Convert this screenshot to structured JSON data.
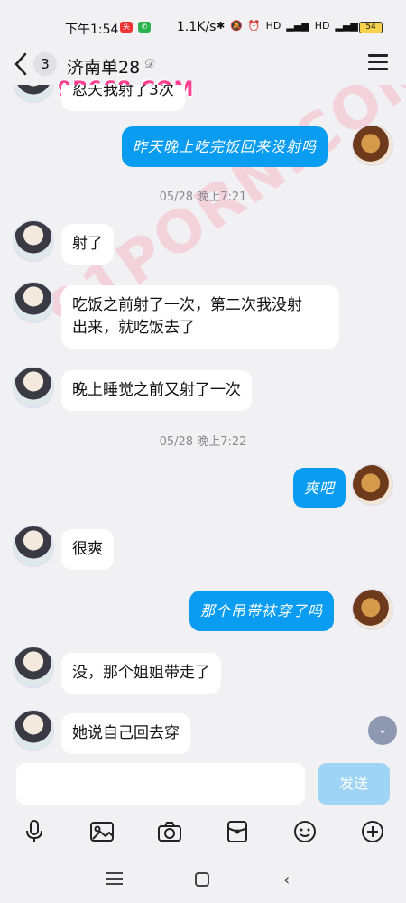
{
  "status_bar": {
    "time": "下午1:54",
    "speed": "1.1K/s",
    "battery": "54"
  },
  "header": {
    "unread_count": "3",
    "title": "济南单28"
  },
  "watermark": {
    "top": "9P668.COM",
    "diagonal": "91PORN.COM"
  },
  "messages": [
    {
      "from": "them",
      "text": "忍天我射了3次"
    },
    {
      "from": "me",
      "text": "昨天晚上吃完饭回来没射吗"
    },
    {
      "from": "time",
      "text": "05/28 晚上7:21"
    },
    {
      "from": "them",
      "text": "射了"
    },
    {
      "from": "them",
      "text": "吃饭之前射了一次，第二次我没射\n出来，就吃饭去了"
    },
    {
      "from": "them",
      "text": "晚上睡觉之前又射了一次"
    },
    {
      "from": "time",
      "text": "05/28 晚上7:22"
    },
    {
      "from": "me",
      "text": "爽吧"
    },
    {
      "from": "them",
      "text": "很爽"
    },
    {
      "from": "me",
      "text": "那个吊带袜穿了吗"
    },
    {
      "from": "them",
      "text": "没，那个姐姐带走了"
    },
    {
      "from": "them",
      "text": "她说自己回去穿"
    }
  ],
  "composer": {
    "placeholder": "",
    "send_label": "发送"
  },
  "toolbar": [
    "microphone-icon",
    "image-icon",
    "camera-icon",
    "red-packet-icon",
    "emoji-icon",
    "plus-icon"
  ]
}
